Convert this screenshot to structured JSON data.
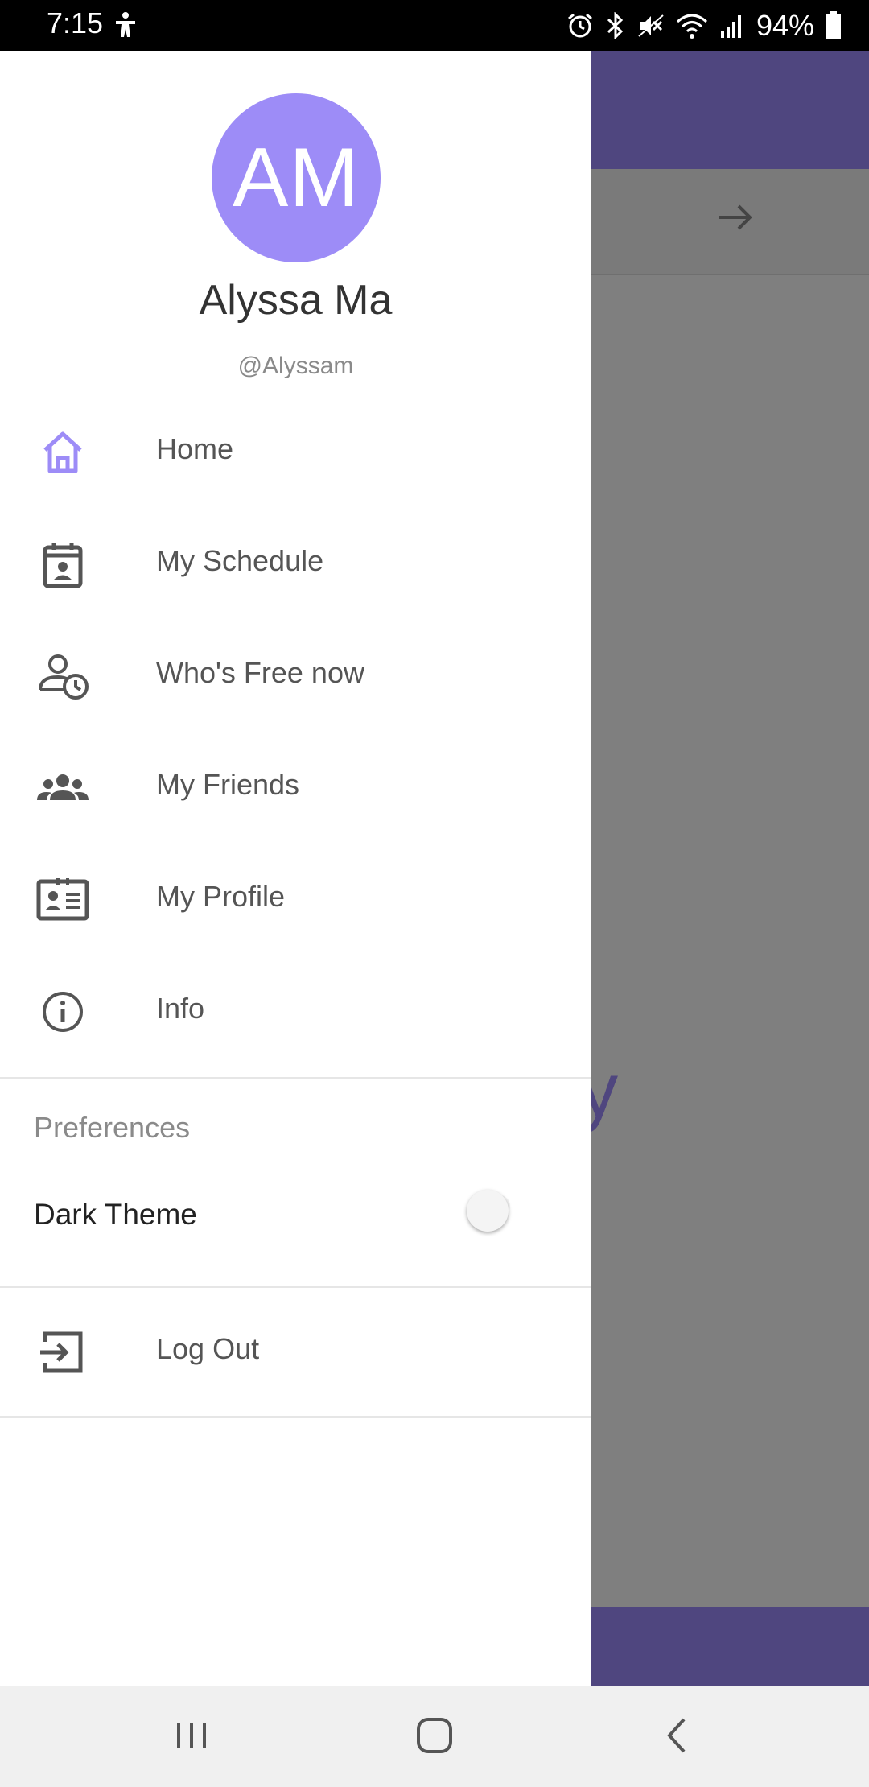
{
  "status_bar": {
    "time": "7:15",
    "battery": "94%",
    "icons": [
      "accessibility-icon",
      "alarm-icon",
      "bluetooth-icon",
      "mute-icon",
      "wifi-icon",
      "signal-icon",
      "battery-icon"
    ]
  },
  "background": {
    "visible_text": "oday",
    "accent_color": "#4f467f"
  },
  "drawer": {
    "avatar_initials": "AM",
    "avatar_color": "#9d8cf7",
    "user_name": "Alyssa Ma",
    "user_handle": "@Alyssam",
    "menu": [
      {
        "label": "Home",
        "icon": "home-icon",
        "active": true
      },
      {
        "label": "My Schedule",
        "icon": "calendar-person-icon"
      },
      {
        "label": "Who's Free now",
        "icon": "person-clock-icon"
      },
      {
        "label": "My Friends",
        "icon": "group-icon"
      },
      {
        "label": "My Profile",
        "icon": "id-card-icon"
      },
      {
        "label": "Info",
        "icon": "info-icon"
      }
    ],
    "preferences": {
      "header": "Preferences",
      "dark_theme_label": "Dark Theme",
      "dark_theme_enabled": false
    },
    "logout_label": "Log Out"
  },
  "nav_bar": {
    "buttons": [
      "recents-icon",
      "home-button-icon",
      "back-icon"
    ]
  }
}
